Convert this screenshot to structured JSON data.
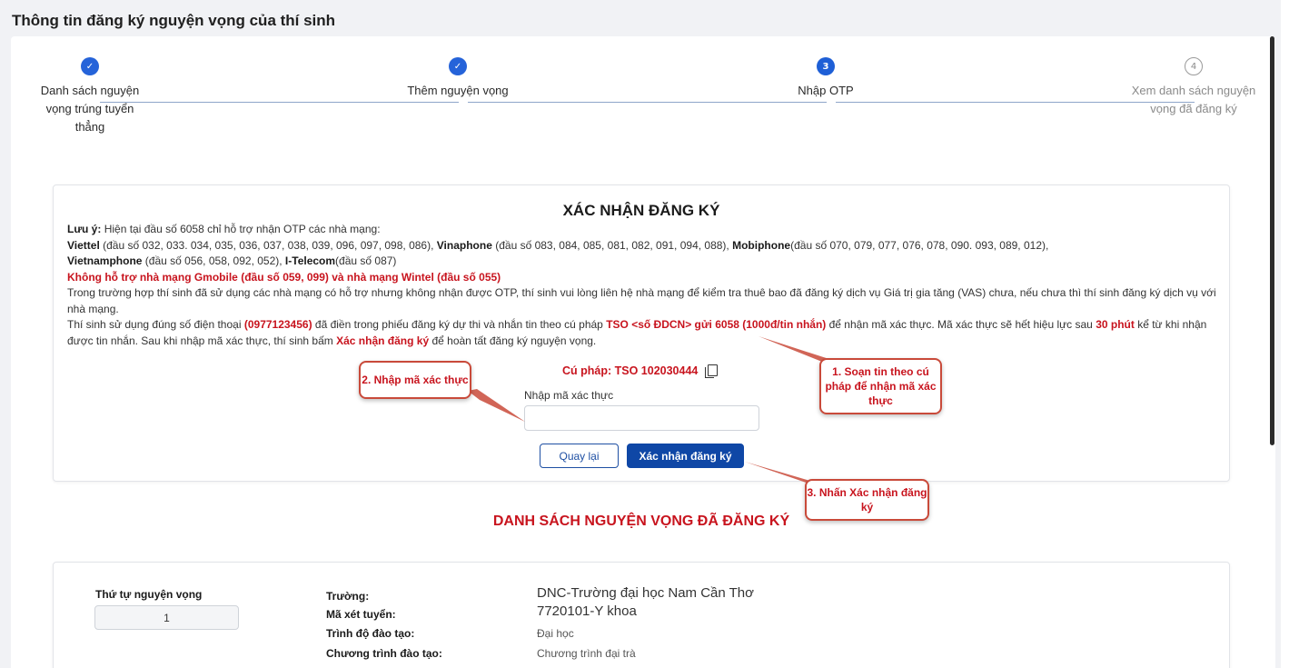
{
  "page": {
    "title": "Thông tin đăng ký nguyện vọng của thí sinh"
  },
  "stepper": {
    "steps": [
      {
        "number": "1",
        "label": "Danh sách nguyện vọng trúng tuyển thẳng",
        "state": "done"
      },
      {
        "number": "2",
        "label": "Thêm nguyện vọng",
        "state": "done"
      },
      {
        "number": "3",
        "label": "Nhập OTP",
        "state": "active"
      },
      {
        "number": "4",
        "label": "Xem danh sách nguyện vọng đã đăng ký",
        "state": "pending"
      }
    ]
  },
  "confirm": {
    "title": "XÁC NHẬN ĐĂNG KÝ",
    "note_prefix": "Lưu ý:",
    "note_text": " Hiện tại đầu số 6058 chỉ hỗ trợ nhận OTP các nhà mạng:",
    "viettel_name": "Viettel",
    "viettel_numbers": " (đầu số 032, 033. 034, 035, 036, 037, 038, 039, 096, 097, 098, 086), ",
    "vinaphone_name": "Vinaphone",
    "vinaphone_numbers": " (đầu số 083, 084, 085, 081, 082, 091, 094, 088), ",
    "mobiphone_name": "Mobiphone",
    "mobiphone_numbers": "(đầu số 070, 079, 077, 076, 078, 090. 093, 089, 012),",
    "vietnamphone_name": "Vietnamphone",
    "vietnamphone_numbers": " (đầu số 056, 058, 092, 052), ",
    "itelecom_name": "I-Telecom",
    "itelecom_numbers": "(đầu số 087)",
    "unsupported": "Không hỗ trợ nhà mạng Gmobile (đầu số 059, 099) và nhà mạng Wintel (đầu số 055)",
    "fallback_text": "Trong trường hợp thí sinh đã sử dụng các nhà mạng có hỗ trợ nhưng không nhận được OTP, thí sinh vui lòng liên hệ nhà mạng để kiểm tra thuê bao đã đăng ký dịch vụ Giá trị gia tăng (VAS) chưa, nếu chưa thì thí sinh đăng ký dịch vụ với nhà mạng.",
    "instr_1": "Thí sinh sử dụng đúng số điện thoại ",
    "phone": "(0977123456)",
    "instr_2": " đã điền trong phiếu đăng ký dự thi và nhắn tin theo cú pháp ",
    "syntax_template": "TSO <số ĐDCN> gửi 6058 (1000đ/tin nhắn)",
    "instr_3": " để nhận mã xác thực. Mã xác thực sẽ hết hiệu lực sau ",
    "expiry": "30 phút",
    "instr_4": " kể từ khi nhận được tin nhắn. Sau khi nhập mã xác thực, thí sinh bấm ",
    "confirm_phrase": "Xác nhận đăng ký",
    "instr_5": " để hoàn tất đăng ký nguyện vọng.",
    "syntax_display": "Cú pháp: TSO 102030444",
    "copy_icon": "copy-icon",
    "otp_label": "Nhập mã xác thực",
    "otp_value": "",
    "otp_placeholder": "",
    "back_button": "Quay lại",
    "confirm_button": "Xác nhận đăng ký"
  },
  "callouts": {
    "enter_code": "2. Nhập mã xác thực",
    "send_sms": "1. Soạn tin theo cú pháp để nhận mã xác thực",
    "press_confirm": "3. Nhấn Xác nhận đăng ký"
  },
  "wish_list": {
    "title": "DANH SÁCH NGUYỆN VỌNG ĐÃ ĐĂNG KÝ",
    "order_label": "Thứ tự nguyện vọng",
    "order_value": "1",
    "school_key": "Trường:",
    "school_value": "DNC-Trường đại học Nam Cần Thơ",
    "code_key": "Mã xét tuyển:",
    "code_value": "7720101-Y khoa",
    "level_key": "Trình độ đào tạo:",
    "level_value": "Đại học",
    "program_key": "Chương trình đào tạo:",
    "program_value": "Chương trình đại trà"
  },
  "colors": {
    "accent_blue": "#0f47a6",
    "step_blue": "#2563d9",
    "alert_red": "#c8141e",
    "callout_border": "#c94a3a"
  }
}
